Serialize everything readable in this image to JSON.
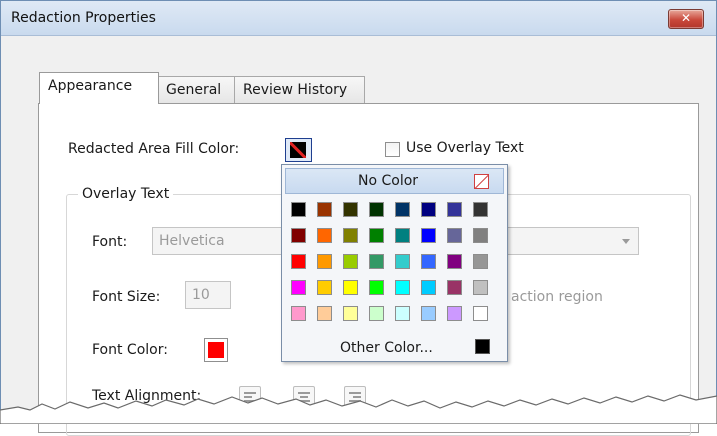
{
  "window": {
    "title": "Redaction Properties",
    "close_icon": "close-x-icon",
    "close_glyph": "✕"
  },
  "tabs": [
    {
      "label": "Appearance",
      "active": true
    },
    {
      "label": "General",
      "active": false
    },
    {
      "label": "Review History",
      "active": false
    }
  ],
  "appearance": {
    "fill_color_label": "Redacted Area Fill Color:",
    "fill_color_value": "No Color",
    "use_overlay_label": "Use Overlay Text",
    "use_overlay_checked": false,
    "overlay_group_label": "Overlay Text",
    "font_label": "Font:",
    "font_value": "Helvetica",
    "font_size_label": "Font Size:",
    "font_size_value": "10",
    "partial_hint_text": "action region",
    "font_color_label": "Font Color:",
    "font_color": "#ff0000",
    "text_alignment_label": "Text Alignment:",
    "alignment_icons": [
      "align-left-icon",
      "align-center-icon",
      "align-right-icon"
    ]
  },
  "color_popup": {
    "no_color_label": "No Color",
    "no_color_icon": "no-color-slash-icon",
    "other_color_label": "Other Color...",
    "other_color_swatch": "#000000",
    "palette": [
      [
        "#000000",
        "#993300",
        "#333300",
        "#003300",
        "#003366",
        "#000080",
        "#333399",
        "#333333"
      ],
      [
        "#800000",
        "#ff6600",
        "#808000",
        "#008000",
        "#008080",
        "#0000ff",
        "#666699",
        "#808080"
      ],
      [
        "#ff0000",
        "#ff9900",
        "#99cc00",
        "#339966",
        "#33cccc",
        "#3366ff",
        "#800080",
        "#969696"
      ],
      [
        "#ff00ff",
        "#ffcc00",
        "#ffff00",
        "#00ff00",
        "#00ffff",
        "#00ccff",
        "#993366",
        "#c0c0c0"
      ],
      [
        "#ff99cc",
        "#ffcc99",
        "#ffff99",
        "#ccffcc",
        "#ccffff",
        "#99ccff",
        "#cc99ff",
        "#ffffff"
      ]
    ]
  }
}
